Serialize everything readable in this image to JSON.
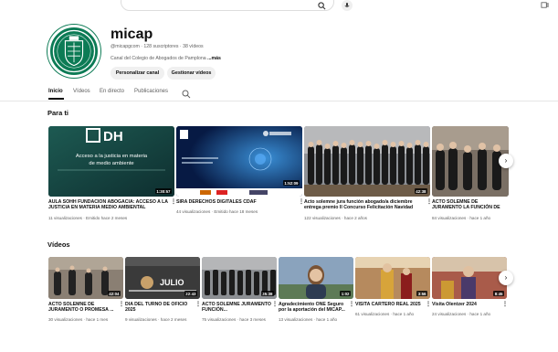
{
  "header": {
    "search_icon": "search-icon",
    "mic_icon": "mic-icon"
  },
  "channel": {
    "name": "micap",
    "meta": "@micapgcom · 128 suscriptores · 38 vídeos",
    "description": "Canal del Colegio de Abogados de Pamplona",
    "more": "...más",
    "customize_label": "Personalizar canal",
    "manage_label": "Gestionar vídeos"
  },
  "tabs": [
    {
      "label": "Inicio"
    },
    {
      "label": "Vídeos"
    },
    {
      "label": "En directo"
    },
    {
      "label": "Publicaciones"
    }
  ],
  "for_you": {
    "title": "Para ti",
    "videos": [
      {
        "title": "AULA SOHH FUNDACIÓN ABOGACÍA: ACCESO A LA JUSTICIA EN MATERIA MEDIO AMBIENTAL",
        "meta": "11 visualizaciones · Emitido hace 2 meses",
        "duration": "1:30:57",
        "thumb_text_1": "Acceso a la justicia en materia",
        "thumb_text_2": "de medio ambiente"
      },
      {
        "title": "SIRA DERECHOS DIGITALES CDAF",
        "meta": "44 visualizaciones · Emitido hace 18 meses",
        "duration": "1:52:09"
      },
      {
        "title": "Acto solemne jura función abogado/a diciembre entrega premio II Concurso Felicitación Navidad",
        "meta": "122 visualizaciones · hace 2 años",
        "duration": "42:38"
      },
      {
        "title": "ACTO SOLEMNE DE JURAMENTO LA FUNCIÓN DE ABOGADO Y ABO",
        "meta": "84 visualizaciones · hace 1 año"
      }
    ]
  },
  "videos_section": {
    "title": "Vídeos",
    "videos": [
      {
        "title": "ACTO SOLEMNE DE JURAMENTO O PROMESA ...",
        "meta": "30 visualizaciones · hace 1 mes",
        "duration": "42:04"
      },
      {
        "title": "DÍA DEL TURNO DE OFICIO 2025",
        "meta": "9 visualizaciones · hace 2 meses",
        "duration": "22:43",
        "thumb_text": "JULIO"
      },
      {
        "title": "ACTO SOLEMNE JURAMENTO FUNCIÓN...",
        "meta": "75 visualizaciones · hace 3 meses",
        "duration": "35:38"
      },
      {
        "title": "Agradecimiento ONE Seguro por la aportación del MICAP...",
        "meta": "13 visualizaciones · hace 1 año",
        "duration": "1:02"
      },
      {
        "title": "VISITA CARTERO REAL 2025",
        "meta": "61 visualizaciones · hace 1 año",
        "duration": "3:56"
      },
      {
        "title": "Visita Olentzer 2024",
        "meta": "24 visualizaciones · hace 1 año",
        "duration": "8:45"
      }
    ]
  },
  "colors": {
    "avatar": "#0c7b55",
    "text": "#0f0f0f",
    "muted": "#606060"
  }
}
